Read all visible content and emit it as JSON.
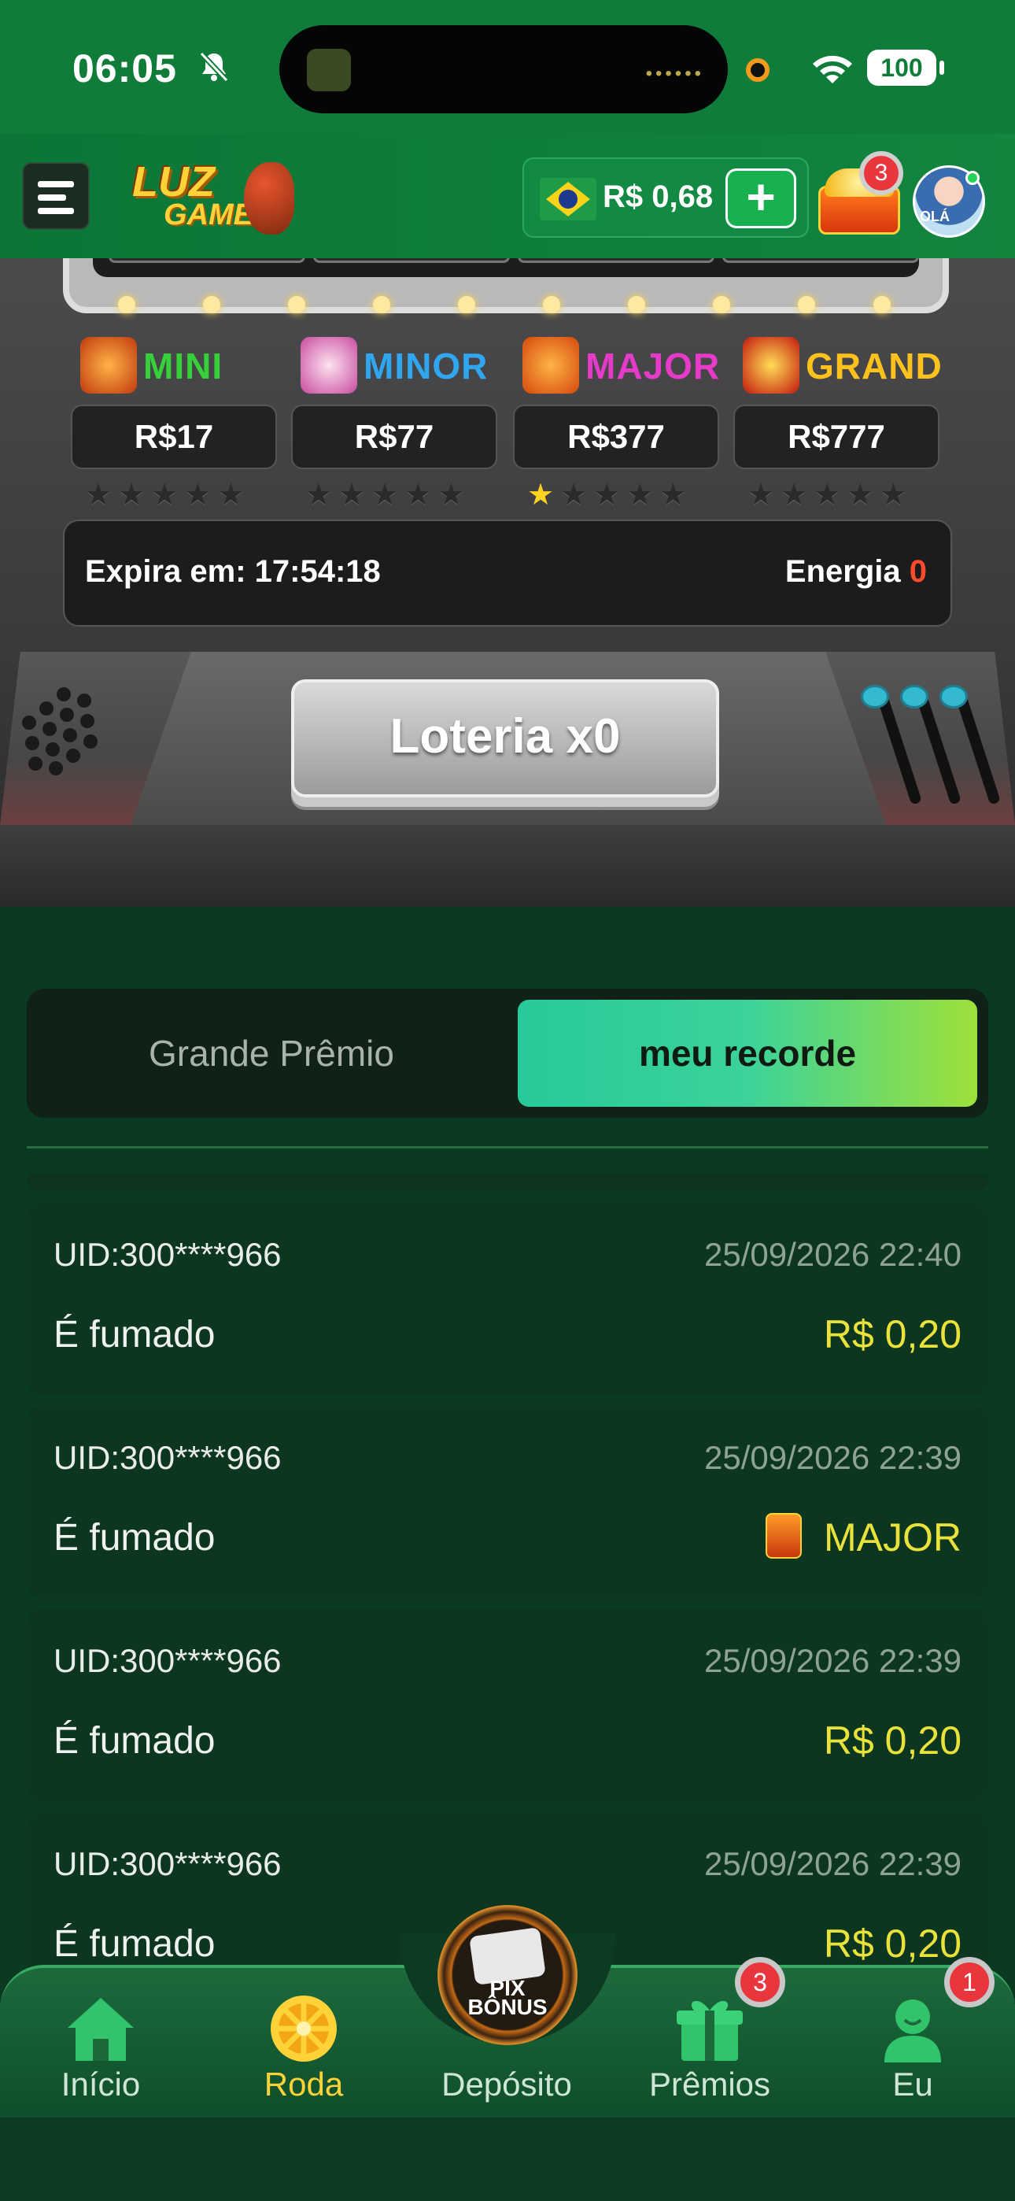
{
  "status_bar": {
    "time": "06:05",
    "battery": "100"
  },
  "header": {
    "logo_top": "LUZ",
    "logo_bottom": "GAMES",
    "balance": "R$ 0,68",
    "add_label": "+",
    "chest_badge": "3",
    "avatar_text": "OLÁ"
  },
  "machine": {
    "jackpots": [
      {
        "name": "MINI",
        "value": "R$17",
        "stars_on": 0,
        "color": "#36d13a"
      },
      {
        "name": "MINOR",
        "value": "R$77",
        "stars_on": 0,
        "color": "#2fa6ef"
      },
      {
        "name": "MAJOR",
        "value": "R$377",
        "stars_on": 1,
        "color": "#e53bc8"
      },
      {
        "name": "GRAND",
        "value": "R$777",
        "stars_on": 0,
        "color": "#ffc21c"
      }
    ],
    "stars_total": 5,
    "expire_label": "Expira em: 17:54:18",
    "energy_label": "Energia",
    "energy_value": "0",
    "lottery_button": "Loteria x0"
  },
  "tabs": {
    "grande": "Grande Prêmio",
    "record": "meu recorde",
    "active": "record"
  },
  "records": [
    {
      "uid": "UID:300****966",
      "date": "25/09/2026 22:40",
      "label": "É fumado",
      "prize": "R$ 0,20",
      "icon": ""
    },
    {
      "uid": "UID:300****966",
      "date": "25/09/2026 22:39",
      "label": "É fumado",
      "prize": "MAJOR",
      "icon": "wild-major-icon"
    },
    {
      "uid": "UID:300****966",
      "date": "25/09/2026 22:39",
      "label": "É fumado",
      "prize": "R$ 0,20",
      "icon": ""
    },
    {
      "uid": "UID:300****966",
      "date": "25/09/2026 22:39",
      "label": "É fumado",
      "prize": "R$ 0,20",
      "icon": ""
    }
  ],
  "bottom_nav": {
    "items": [
      {
        "label": "Início",
        "icon": "home-icon"
      },
      {
        "label": "Roda",
        "icon": "wheel-icon",
        "active": true
      },
      {
        "label": "Depósito",
        "icon": "pix-bonus-icon"
      },
      {
        "label": "Prêmios",
        "icon": "gift-icon",
        "badge": "3"
      },
      {
        "label": "Eu",
        "icon": "user-icon",
        "badge": "1"
      }
    ],
    "pix_line1": "PIX",
    "pix_line2": "BÔNUS"
  },
  "colors": {
    "brand_green": "#0f7c3a",
    "accent_yellow": "#e8e23a",
    "energy_red": "#ff4a2c",
    "badge_red": "#e8363c"
  }
}
